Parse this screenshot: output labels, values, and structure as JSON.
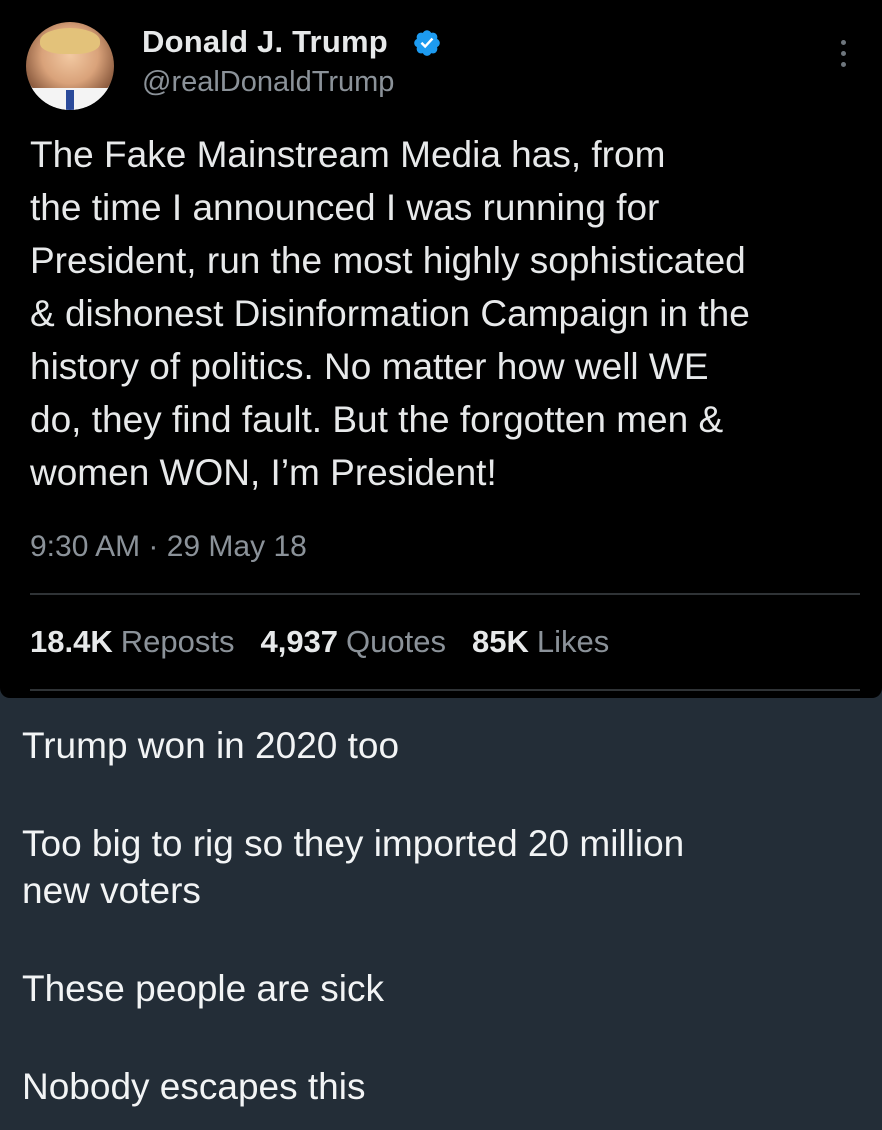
{
  "tweet": {
    "display_name": "Donald J. Trump",
    "handle": "@realDonaldTrump",
    "avatar_icon": "avatar-photo",
    "verified_icon": "verified-badge-icon",
    "verified_color": "#1d9bf0",
    "more_icon": "more-vertical-icon",
    "body_lines": [
      "The Fake Mainstream Media has, from",
      "the time I announced I was running for",
      "President, run the most highly sophisticated",
      "& dishonest Disinformation Campaign in the",
      "history of politics. No matter how well WE",
      "do, they find fault. But the forgotten men &",
      "women WON, I’m President!"
    ],
    "timestamp": "9:30 AM · 29 May 18",
    "stats": {
      "reposts_count": "18.4K",
      "reposts_label": "Reposts",
      "quotes_count": "4,937",
      "quotes_label": "Quotes",
      "likes_count": "85K",
      "likes_label": "Likes"
    }
  },
  "post": {
    "paragraphs": [
      "Trump won in 2020 too",
      "Too big to rig so they imported 20 million",
      "new voters",
      "These people are sick",
      "Nobody escapes this"
    ]
  },
  "colors": {
    "page_background": "#232d37",
    "tweet_background": "#000000",
    "primary_text": "#e7e9ea",
    "secondary_text": "#8b9299"
  }
}
